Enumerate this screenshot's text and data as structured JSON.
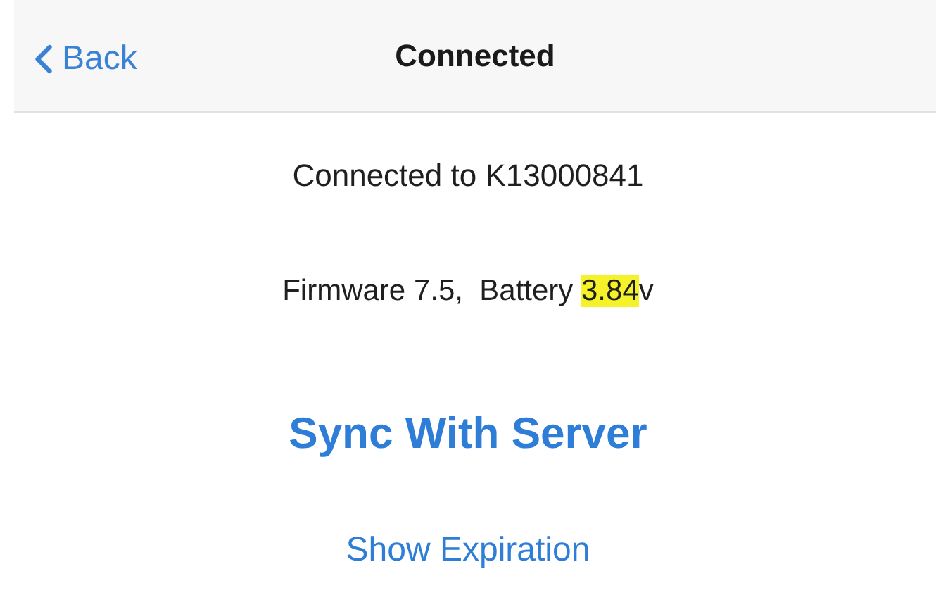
{
  "nav_bar": {
    "back": "Back",
    "title": "Connected"
  },
  "connection": "Connected to K13000841",
  "device_info": {
    "text": "Firmware 7.5,  Battery ",
    "highlight": "3.84",
    "suffix": "v"
  },
  "actions": [
    {
      "label": "Sync With Server",
      "kind": "primary"
    },
    {
      "label": "Show Expiration",
      "kind": "secondary"
    }
  ]
}
